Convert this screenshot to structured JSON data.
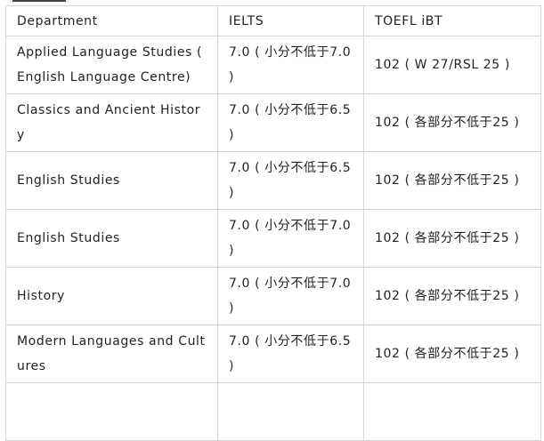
{
  "table": {
    "headers": [
      "Department",
      "IELTS",
      "TOEFL iBT"
    ],
    "rows": [
      {
        "department": "Applied  Language Studies ( English Language Centre)",
        "ielts": "7.0 ( 小分不低于7.0 )",
        "toefl": "102 ( W 27/RSL 25 )"
      },
      {
        "department": "Classics  and Ancient History",
        "ielts": "7.0 ( 小分不低于6.5 )",
        "toefl": "102 ( 各部分不低于25 )"
      },
      {
        "department": "English  Studies",
        "ielts": "7.0 ( 小分不低于6.5 )",
        "toefl": "102 ( 各部分不低于25 )"
      },
      {
        "department": "English  Studies",
        "ielts": "7.0 ( 小分不低于7.0 )",
        "toefl": "102 ( 各部分不低于25 )"
      },
      {
        "department": "History",
        "ielts": "7.0 ( 小分不低于7.0 )",
        "toefl": "102 ( 各部分不低于25 )"
      },
      {
        "department": "Modern  Languages and Cultures",
        "ielts": "7.0 ( 小分不低于6.5 )",
        "toefl": "102 ( 各部分不低于25 )"
      }
    ]
  }
}
